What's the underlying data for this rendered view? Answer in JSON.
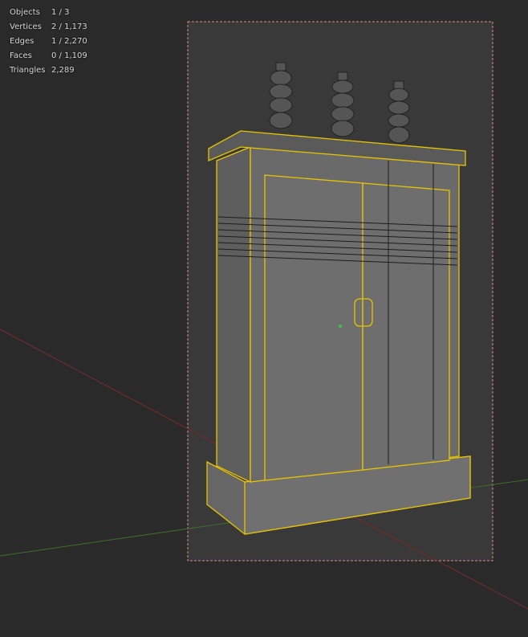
{
  "stats": [
    {
      "label": "Objects",
      "value": "1 / 3"
    },
    {
      "label": "Vertices",
      "value": "2 / 1,173"
    },
    {
      "label": "Edges",
      "value": "1 / 2,270"
    },
    {
      "label": "Faces",
      "value": "0 / 1,109"
    },
    {
      "label": "Triangles",
      "value": "2,289"
    }
  ],
  "colors": {
    "background": "#2a2a2a",
    "camera_frame": "#393939",
    "selection": "#e8c400",
    "x_axis": "#7a2a2a",
    "y_axis": "#3e6e2a",
    "mesh": "#6e6e6e"
  }
}
